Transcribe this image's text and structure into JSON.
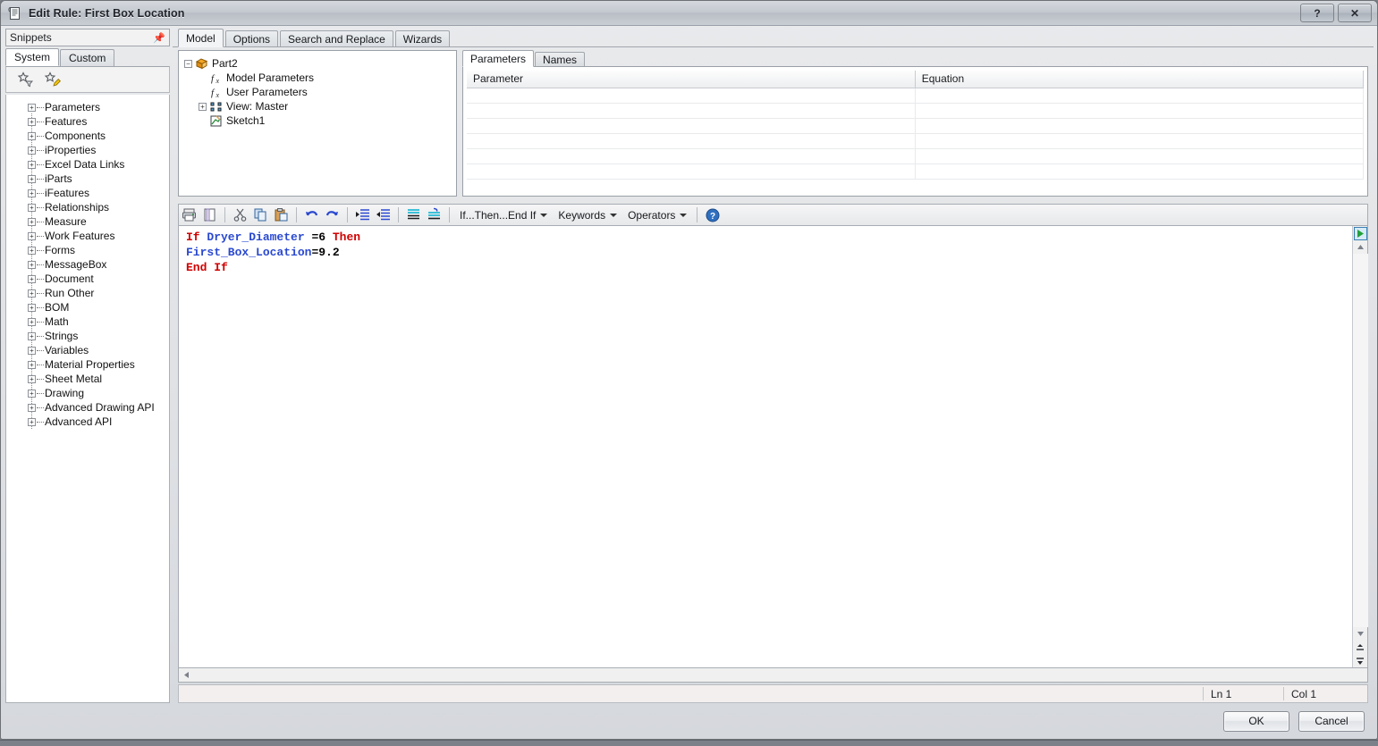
{
  "window": {
    "title": "Edit Rule: First Box Location",
    "icon": "rule-scroll-icon",
    "help_label": "?",
    "close_label": "✕"
  },
  "snippets": {
    "header": "Snippets",
    "pin_icon": "pin-icon",
    "tabs": [
      {
        "label": "System",
        "active": true
      },
      {
        "label": "Custom",
        "active": false
      }
    ],
    "tools": [
      {
        "name": "filter-snippets-icon"
      },
      {
        "name": "edit-snippets-icon"
      }
    ],
    "tree": [
      "Parameters",
      "Features",
      "Components",
      "iProperties",
      "Excel Data Links",
      "iParts",
      "iFeatures",
      "Relationships",
      "Measure",
      "Work Features",
      "Forms",
      "MessageBox",
      "Document",
      "Run Other",
      "BOM",
      "Math",
      "Strings",
      "Variables",
      "Material Properties",
      "Sheet Metal",
      "Drawing",
      "Advanced Drawing API",
      "Advanced API"
    ]
  },
  "main_tabs": [
    {
      "label": "Model",
      "active": true
    },
    {
      "label": "Options",
      "active": false
    },
    {
      "label": "Search and Replace",
      "active": false
    },
    {
      "label": "Wizards",
      "active": false
    }
  ],
  "model_tree": [
    {
      "label": "Part2",
      "indent": 0,
      "expander": "−",
      "icon": "part-cube-icon"
    },
    {
      "label": "Model Parameters",
      "indent": 1,
      "expander": "",
      "icon": "fx-icon"
    },
    {
      "label": "User Parameters",
      "indent": 1,
      "expander": "",
      "icon": "fx-icon"
    },
    {
      "label": "View: Master",
      "indent": 1,
      "expander": "+",
      "icon": "view-icon"
    },
    {
      "label": "Sketch1",
      "indent": 1,
      "expander": "",
      "icon": "sketch-icon"
    }
  ],
  "param_tabs": [
    {
      "label": "Parameters",
      "active": true
    },
    {
      "label": "Names",
      "active": false
    }
  ],
  "param_table": {
    "columns": [
      "Parameter",
      "Equation"
    ],
    "rows": [],
    "empty_row_count": 6
  },
  "editor_toolbar": {
    "buttons": [
      {
        "name": "print-icon"
      },
      {
        "name": "print-preview-icon"
      },
      {
        "name": "cut-icon"
      },
      {
        "name": "copy-icon"
      },
      {
        "name": "paste-icon"
      },
      {
        "name": "undo-icon"
      },
      {
        "name": "redo-icon"
      },
      {
        "name": "indent-icon"
      },
      {
        "name": "outdent-icon"
      },
      {
        "name": "comment-block-icon"
      },
      {
        "name": "uncomment-block-icon"
      }
    ],
    "dropdowns": [
      {
        "label": "If...Then...End If"
      },
      {
        "label": "Keywords"
      },
      {
        "label": "Operators"
      }
    ],
    "help_icon": "help-circle-icon"
  },
  "code": {
    "lines": [
      {
        "tokens": [
          {
            "t": "If ",
            "c": "kw"
          },
          {
            "t": "Dryer_Diameter ",
            "c": "id"
          },
          {
            "t": "=6 ",
            "c": "num"
          },
          {
            "t": "Then",
            "c": "kw"
          }
        ]
      },
      {
        "tokens": [
          {
            "t": "First_Box_Location",
            "c": "id"
          },
          {
            "t": "=9.2",
            "c": "num"
          }
        ]
      },
      {
        "tokens": [
          {
            "t": "End If",
            "c": "kw"
          }
        ]
      }
    ],
    "run_button_icon": "run-play-icon"
  },
  "status": {
    "line": "Ln 1",
    "column": "Col 1"
  },
  "footer": {
    "ok_label": "OK",
    "cancel_label": "Cancel"
  },
  "colors": {
    "keyword": "#d00000",
    "identifier": "#2a49d0",
    "accent_run": "#22a03b"
  }
}
